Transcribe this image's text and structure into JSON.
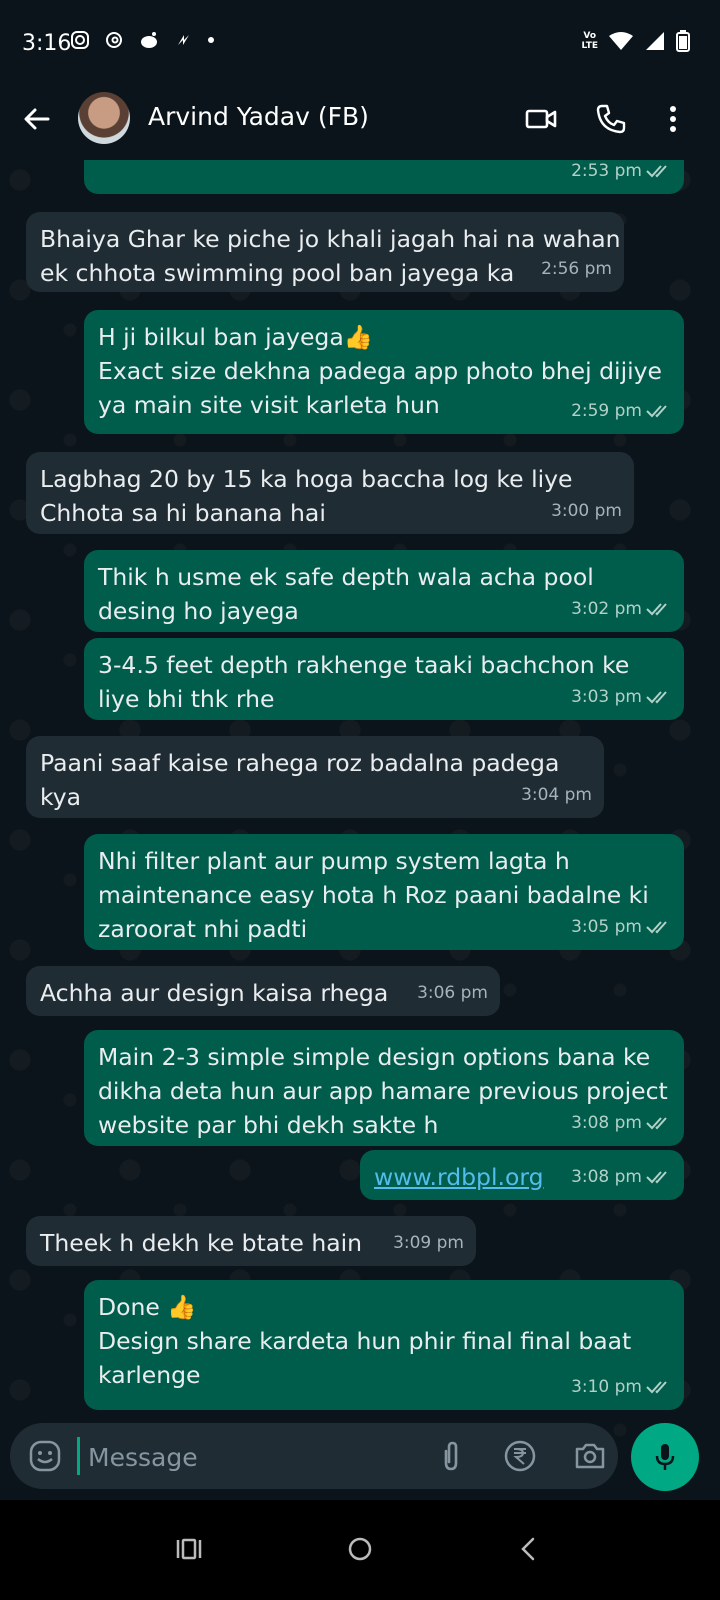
{
  "status_bar": {
    "time": "3:16",
    "network_label": "Vo​LTE"
  },
  "header": {
    "contact_name": "Arvind Yadav (FB)"
  },
  "messages": [
    {
      "dir": "out",
      "text": "",
      "time": "2:53 pm",
      "read": true
    },
    {
      "dir": "in",
      "text": "Bhaiya Ghar ke piche jo khali jagah hai na wahan\nek chhota swimming pool ban jayega ka",
      "time": "2:56 pm"
    },
    {
      "dir": "out",
      "text": "H ji bilkul ban jayega👍\nExact size dekhna padega app photo bhej dijiye\nya main site visit karleta hun",
      "time": "2:59 pm",
      "read": true
    },
    {
      "dir": "in",
      "text": "Lagbhag 20 by 15 ka hoga baccha log ke liye\nChhota sa hi banana hai",
      "time": "3:00 pm"
    },
    {
      "dir": "out",
      "text": "Thik h usme ek safe depth wala acha pool\ndesing ho jayega",
      "time": "3:02 pm",
      "read": true
    },
    {
      "dir": "out",
      "text": "3-4.5 feet depth rakhenge taaki bachchon ke\nliye bhi thk rhe",
      "time": "3:03 pm",
      "read": true
    },
    {
      "dir": "in",
      "text": "Paani saaf kaise rahega roz badalna padega kya",
      "time": "3:04 pm"
    },
    {
      "dir": "out",
      "text": "Nhi  filter plant aur pump system lagta h\nmaintenance easy hota h Roz paani badalne ki\nzaroorat nhi padti",
      "time": "3:05 pm",
      "read": true
    },
    {
      "dir": "in",
      "text": "Achha aur design kaisa rhega",
      "time": "3:06 pm"
    },
    {
      "dir": "out",
      "text": "Main 2-3 simple simple design options bana ke\ndikha deta hun aur app hamare previous project\nwebsite par bhi dekh sakte h",
      "time": "3:08 pm",
      "read": true
    },
    {
      "dir": "out",
      "text": "www.rdbpl.org",
      "time": "3:08 pm",
      "read": true,
      "is_link": true
    },
    {
      "dir": "in",
      "text": "Theek h dekh ke btate hain",
      "time": "3:09 pm"
    },
    {
      "dir": "out",
      "text": "Done 👍\nDesign share kardeta hun phir final final baat\nkarlenge",
      "time": "3:10 pm",
      "read": true
    }
  ],
  "input": {
    "placeholder": "Message",
    "value": ""
  },
  "colors": {
    "incoming_bubble": "#202c33",
    "outgoing_bubble": "#005c4b",
    "accent": "#00a884",
    "link": "#53bdeb",
    "background": "#0b141a"
  },
  "icons": [
    "back-arrow-icon",
    "video-call-icon",
    "phone-call-icon",
    "more-options-icon",
    "emoji-icon",
    "attach-icon",
    "rupee-payment-icon",
    "camera-icon",
    "mic-icon",
    "recents-nav-icon",
    "home-nav-icon",
    "back-nav-icon"
  ]
}
